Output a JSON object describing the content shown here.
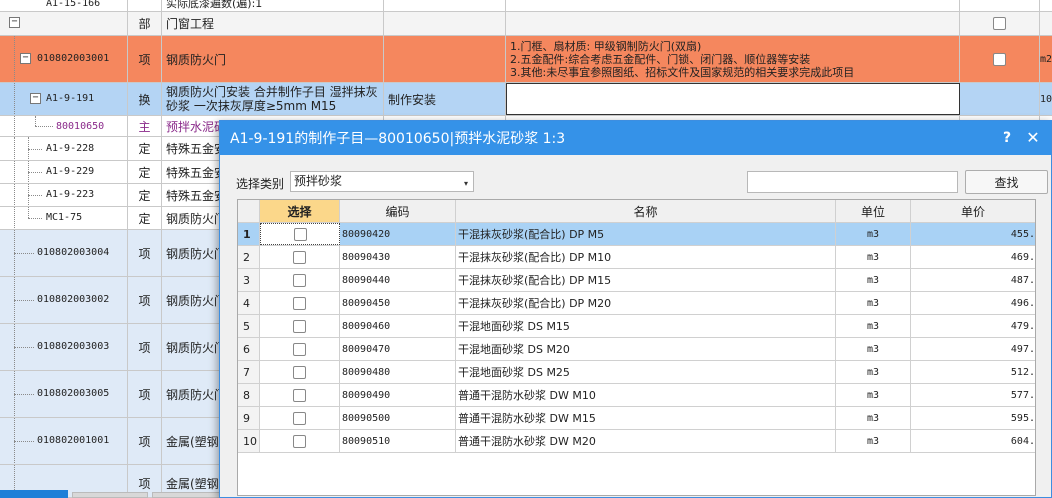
{
  "background_table": {
    "partial_top_row": {
      "code": "A1-15-166",
      "name": "实际底漆遍数(遍):1"
    },
    "rows": [
      {
        "code": "",
        "type": "部",
        "name": "门窗工程",
        "content": "",
        "desc": ""
      },
      {
        "code": "010802003001",
        "type": "项",
        "name": "钢质防火门",
        "content": "",
        "desc_lines": [
          "1.门框、扇材质: 甲级钢制防火门(双扇)",
          "2.五金配件:综合考虑五金配件、门锁、闭门器、顺位器等安装",
          "3.其他:未尽事宜参照图纸、招标文件及国家规范的相关要求完成此项目"
        ],
        "qty": "m2"
      },
      {
        "code": "A1-9-191",
        "type": "换",
        "name": "钢质防火门安装  合并制作子目 湿拌抹灰砂浆 一次抹灰厚度≥5mm M15",
        "content": "制作安装",
        "desc": "",
        "qty": "10"
      },
      {
        "code": "80010650",
        "type": "主",
        "name": "预拌水泥砂浆"
      },
      {
        "code": "A1-9-228",
        "type": "定",
        "name": "特殊五金安装"
      },
      {
        "code": "A1-9-229",
        "type": "定",
        "name": "特殊五金安装"
      },
      {
        "code": "A1-9-223",
        "type": "定",
        "name": "特殊五金安装"
      },
      {
        "code": "MC1-75",
        "type": "定",
        "name": "钢质防火门"
      },
      {
        "code": "010802003004",
        "type": "项",
        "name": "钢质防火门"
      },
      {
        "code": "010802003002",
        "type": "项",
        "name": "钢质防火门"
      },
      {
        "code": "010802003003",
        "type": "项",
        "name": "钢质防火门"
      },
      {
        "code": "010802003005",
        "type": "项",
        "name": "钢质防火门"
      },
      {
        "code": "010802001001",
        "type": "项",
        "name": "金属(塑钢)门"
      },
      {
        "code": "",
        "type": "项",
        "name": "金属(塑钢)门"
      }
    ],
    "expander_minus": "−"
  },
  "dialog": {
    "title": "A1-9-191的制作子目—80010650|预拌水泥砂浆 1:3",
    "help_label": "?",
    "close_label": "✕",
    "category_label": "选择类别",
    "category_value": "预拌砂浆",
    "category_arrow": "▾",
    "search_placeholder": "",
    "search_value": "",
    "search_button": "查找",
    "columns": {
      "select": "选择",
      "code": "编码",
      "name": "名称",
      "unit": "单位",
      "price": "单价"
    },
    "rows": [
      {
        "num": "1",
        "code": "80090420",
        "name": "干混抹灰砂浆(配合比) DP M5",
        "unit": "m3",
        "price": "455."
      },
      {
        "num": "2",
        "code": "80090430",
        "name": "干混抹灰砂浆(配合比) DP M10",
        "unit": "m3",
        "price": "469."
      },
      {
        "num": "3",
        "code": "80090440",
        "name": "干混抹灰砂浆(配合比) DP M15",
        "unit": "m3",
        "price": "487."
      },
      {
        "num": "4",
        "code": "80090450",
        "name": "干混抹灰砂浆(配合比) DP M20",
        "unit": "m3",
        "price": "496."
      },
      {
        "num": "5",
        "code": "80090460",
        "name": "干混地面砂浆 DS M15",
        "unit": "m3",
        "price": "479."
      },
      {
        "num": "6",
        "code": "80090470",
        "name": "干混地面砂浆 DS M20",
        "unit": "m3",
        "price": "497."
      },
      {
        "num": "7",
        "code": "80090480",
        "name": "干混地面砂浆 DS M25",
        "unit": "m3",
        "price": "512."
      },
      {
        "num": "8",
        "code": "80090490",
        "name": "普通干混防水砂浆 DW M10",
        "unit": "m3",
        "price": "577."
      },
      {
        "num": "9",
        "code": "80090500",
        "name": "普通干混防水砂浆 DW M15",
        "unit": "m3",
        "price": "595."
      },
      {
        "num": "10",
        "code": "80090510",
        "name": "普通干混防水砂浆 DW M20",
        "unit": "m3",
        "price": "604."
      }
    ]
  },
  "colors": {
    "orange_row": "#f5875e",
    "selected_blue": "#b4d4f4",
    "dialog_title": "#3592e8",
    "header_highlight": "#fbd78a"
  }
}
